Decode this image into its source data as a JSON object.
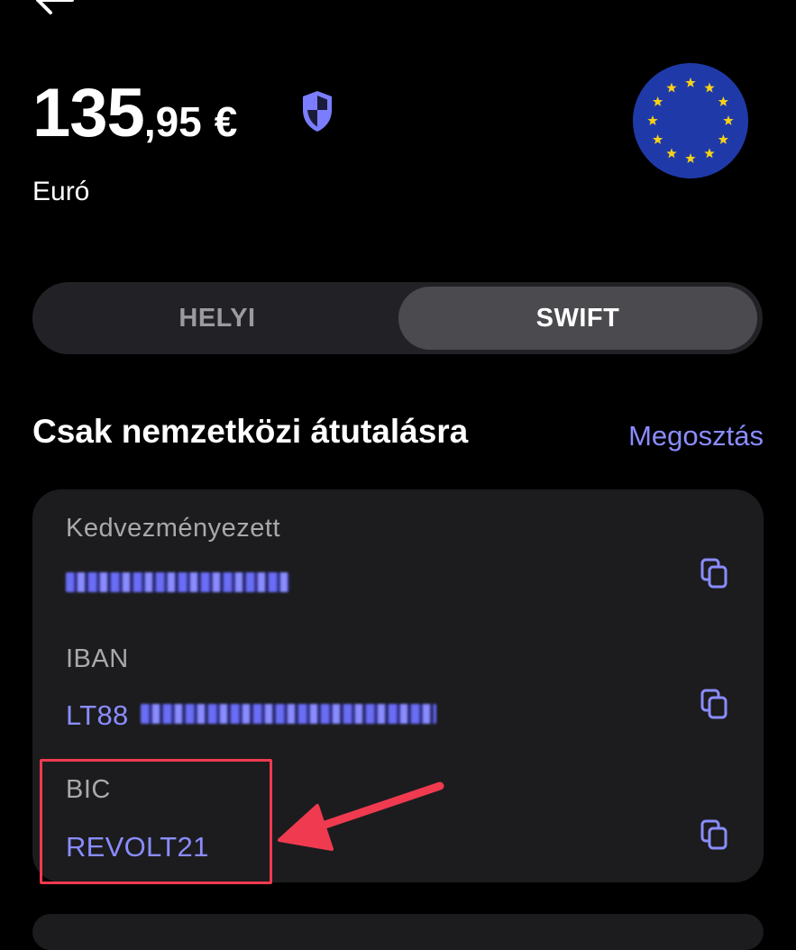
{
  "header": {
    "back_icon": "arrow-left-icon"
  },
  "balance": {
    "integer": "135",
    "decimal": ",95",
    "currency_symbol": "€",
    "protection_icon": "shield-icon"
  },
  "account": {
    "currency_name": "Euró",
    "flag_icon": "eu-flag-icon"
  },
  "tabs": [
    {
      "label": "HELYI",
      "selected": false
    },
    {
      "label": "SWIFT",
      "selected": true
    }
  ],
  "section": {
    "title": "Csak nemzetközi átutalásra",
    "share_label": "Megosztás"
  },
  "details": {
    "beneficiary_label": "Kedvezményezett",
    "iban_label": "IBAN",
    "iban_prefix": "LT88",
    "bic_label": "BIC",
    "bic_value": "REVOLT21"
  },
  "colors": {
    "accent": "#8a8cff",
    "card": "#1c1c1e",
    "annotation": "#ef3a4f"
  }
}
